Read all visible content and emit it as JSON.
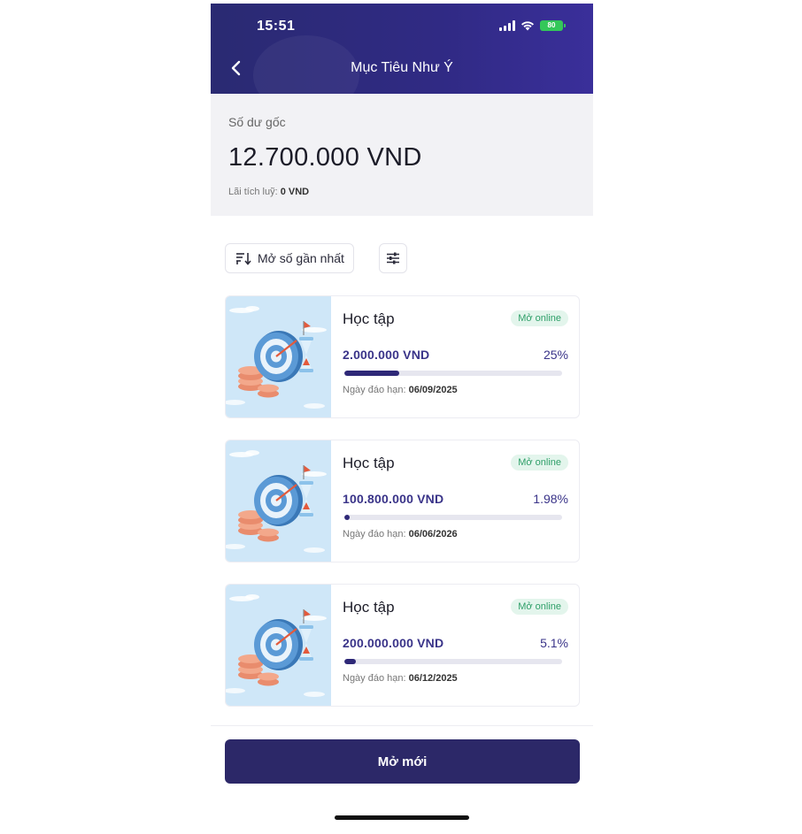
{
  "status_bar": {
    "time": "15:51",
    "battery": "80"
  },
  "nav": {
    "title": "Mục Tiêu Như Ý"
  },
  "balance": {
    "label": "Số dư gốc",
    "value": "12.700.000 VND",
    "accrued_label": "Lãi tích luỹ:",
    "accrued_value": "0 VND"
  },
  "sort": {
    "label": "Mở số gần nhất"
  },
  "cards": [
    {
      "name": "Học tập",
      "badge": "Mở online",
      "amount": "2.000.000 VND",
      "percent": "25%",
      "progress": 0.25,
      "maturity_label": "Ngày đáo hạn:",
      "maturity_date": "06/09/2025"
    },
    {
      "name": "Học tập",
      "badge": "Mở online",
      "amount": "100.800.000 VND",
      "percent": "1.98%",
      "progress": 0.0198,
      "maturity_label": "Ngày đáo hạn:",
      "maturity_date": "06/06/2026"
    },
    {
      "name": "Học tập",
      "badge": "Mở online",
      "amount": "200.000.000 VND",
      "percent": "5.1%",
      "progress": 0.051,
      "maturity_label": "Ngày đáo hạn:",
      "maturity_date": "06/12/2025"
    }
  ],
  "footer": {
    "open_new_label": "Mở mới"
  },
  "icons": {
    "back": "chevron-left-icon",
    "sort": "sort-icon",
    "filter": "filter-sliders-icon",
    "card_image": "target-coins-hourglass-illustration"
  },
  "colors": {
    "header": "#2a2a72",
    "primary": "#2c2868",
    "progress": "#2e2877",
    "badge_bg": "#e3f5ec",
    "badge_text": "#2f9f69"
  }
}
